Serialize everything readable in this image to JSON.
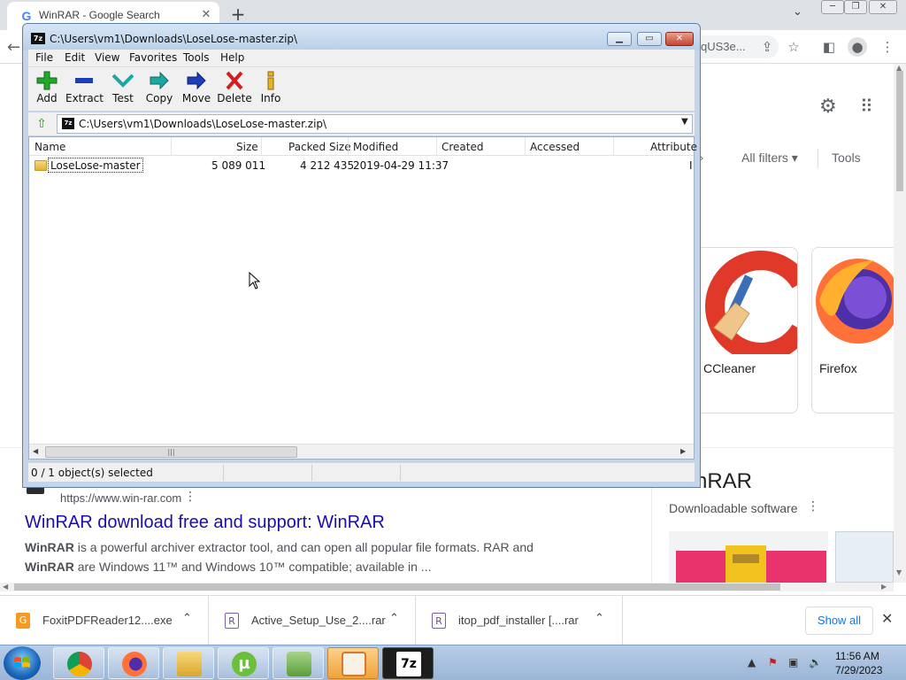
{
  "browser": {
    "tab_title": "WinRAR - Google Search",
    "tab_favicon": "G",
    "new_tab": "+",
    "omnibox_text": "qUS3e...",
    "settings_icon": "gear-icon",
    "apps_icon": "grid-icon",
    "filters": {
      "all_filters": "All filters",
      "tools": "Tools"
    },
    "cards": [
      {
        "label": "CCleaner"
      },
      {
        "label": "Firefox"
      }
    ],
    "result": {
      "url": "https://www.win-rar.com",
      "title": "WinRAR download free and support: WinRAR",
      "snippet_line1_bold": "WinRAR",
      "snippet_line1": " is a powerful archiver extractor tool, and can open all popular file formats. RAR and",
      "snippet_line2_bold": "WinRAR",
      "snippet_line2": " are Windows 11™ and Windows 10™ compatible; available in ..."
    },
    "knowledge_panel": {
      "title": "WinRAR",
      "subtitle": "Downloadable software"
    }
  },
  "downloads": {
    "items": [
      {
        "name": "FoxitPDFReader12....exe"
      },
      {
        "name": "Active_Setup_Use_2....rar"
      },
      {
        "name": "itop_pdf_installer [....rar"
      }
    ],
    "show_all": "Show all"
  },
  "taskbar": {
    "clock_time": "11:56 AM",
    "clock_date": "7/29/2023",
    "apps": [
      "Chrome",
      "Firefox",
      "Windows Explorer",
      "uTorrent",
      "Notepad++",
      "Archive manager",
      "7-Zip"
    ]
  },
  "sevenzip": {
    "app_icon": "7z",
    "title": "C:\\Users\\vm1\\Downloads\\LoseLose-master.zip\\",
    "menu": [
      "File",
      "Edit",
      "View",
      "Favorites",
      "Tools",
      "Help"
    ],
    "tools": [
      "Add",
      "Extract",
      "Test",
      "Copy",
      "Move",
      "Delete",
      "Info"
    ],
    "address": "C:\\Users\\vm1\\Downloads\\LoseLose-master.zip\\",
    "columns": [
      "Name",
      "Size",
      "Packed Size",
      "Modified",
      "Created",
      "Accessed",
      "Attribute"
    ],
    "rows": [
      {
        "name": "LoseLose-master",
        "size": "5 089 011",
        "packed": "4 212 435",
        "modified": "2019-04-29 11:37",
        "created": "",
        "accessed": "",
        "attr": "I"
      }
    ],
    "status": "0 / 1 object(s) selected"
  }
}
